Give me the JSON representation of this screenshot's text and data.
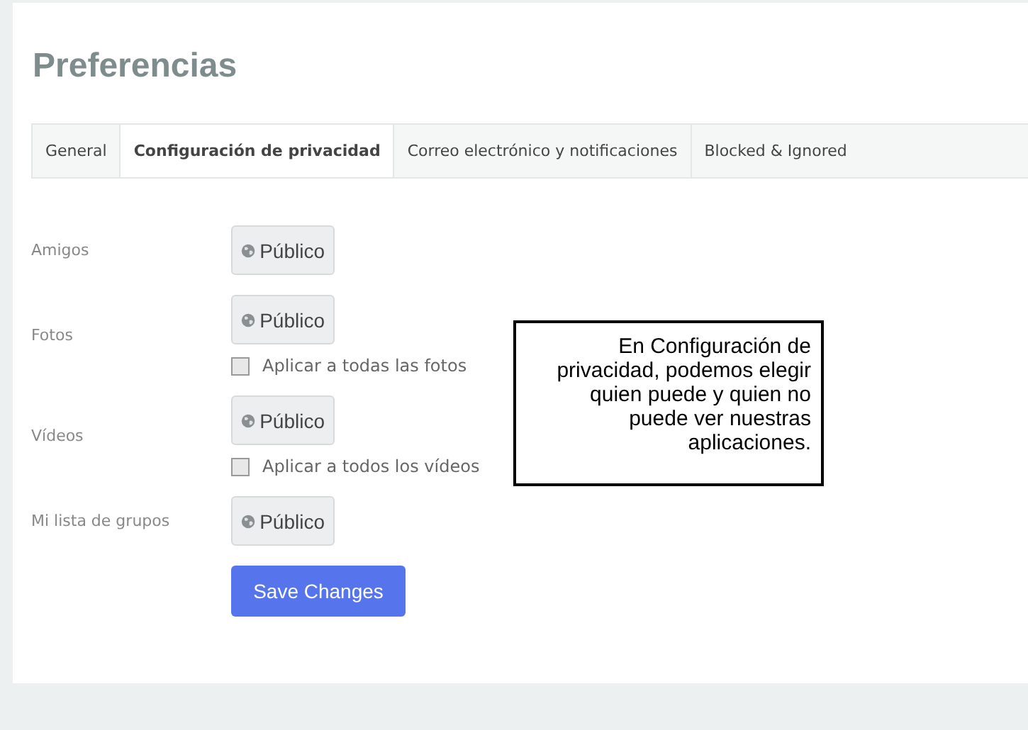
{
  "page_title": "Preferencias",
  "tabs": [
    {
      "label": "General",
      "selected": false
    },
    {
      "label": "Configuración de privacidad",
      "selected": true
    },
    {
      "label": "Correo electrónico y notificaciones",
      "selected": false
    },
    {
      "label": "Blocked & Ignored",
      "selected": false
    }
  ],
  "settings": [
    {
      "label": "Amigos",
      "privacy": "Público"
    },
    {
      "label": "Fotos",
      "privacy": "Público",
      "apply_all": {
        "label": "Aplicar a todas las fotos",
        "checked": false
      }
    },
    {
      "label": "Vídeos",
      "privacy": "Público",
      "apply_all": {
        "label": "Aplicar a todos los vídeos",
        "checked": false
      }
    },
    {
      "label": "Mi lista de grupos",
      "privacy": "Público"
    }
  ],
  "save_button": "Save Changes",
  "callout": "En Configuración de privacidad, podemos elegir quien puede y quien no puede ver nuestras aplicaciones."
}
